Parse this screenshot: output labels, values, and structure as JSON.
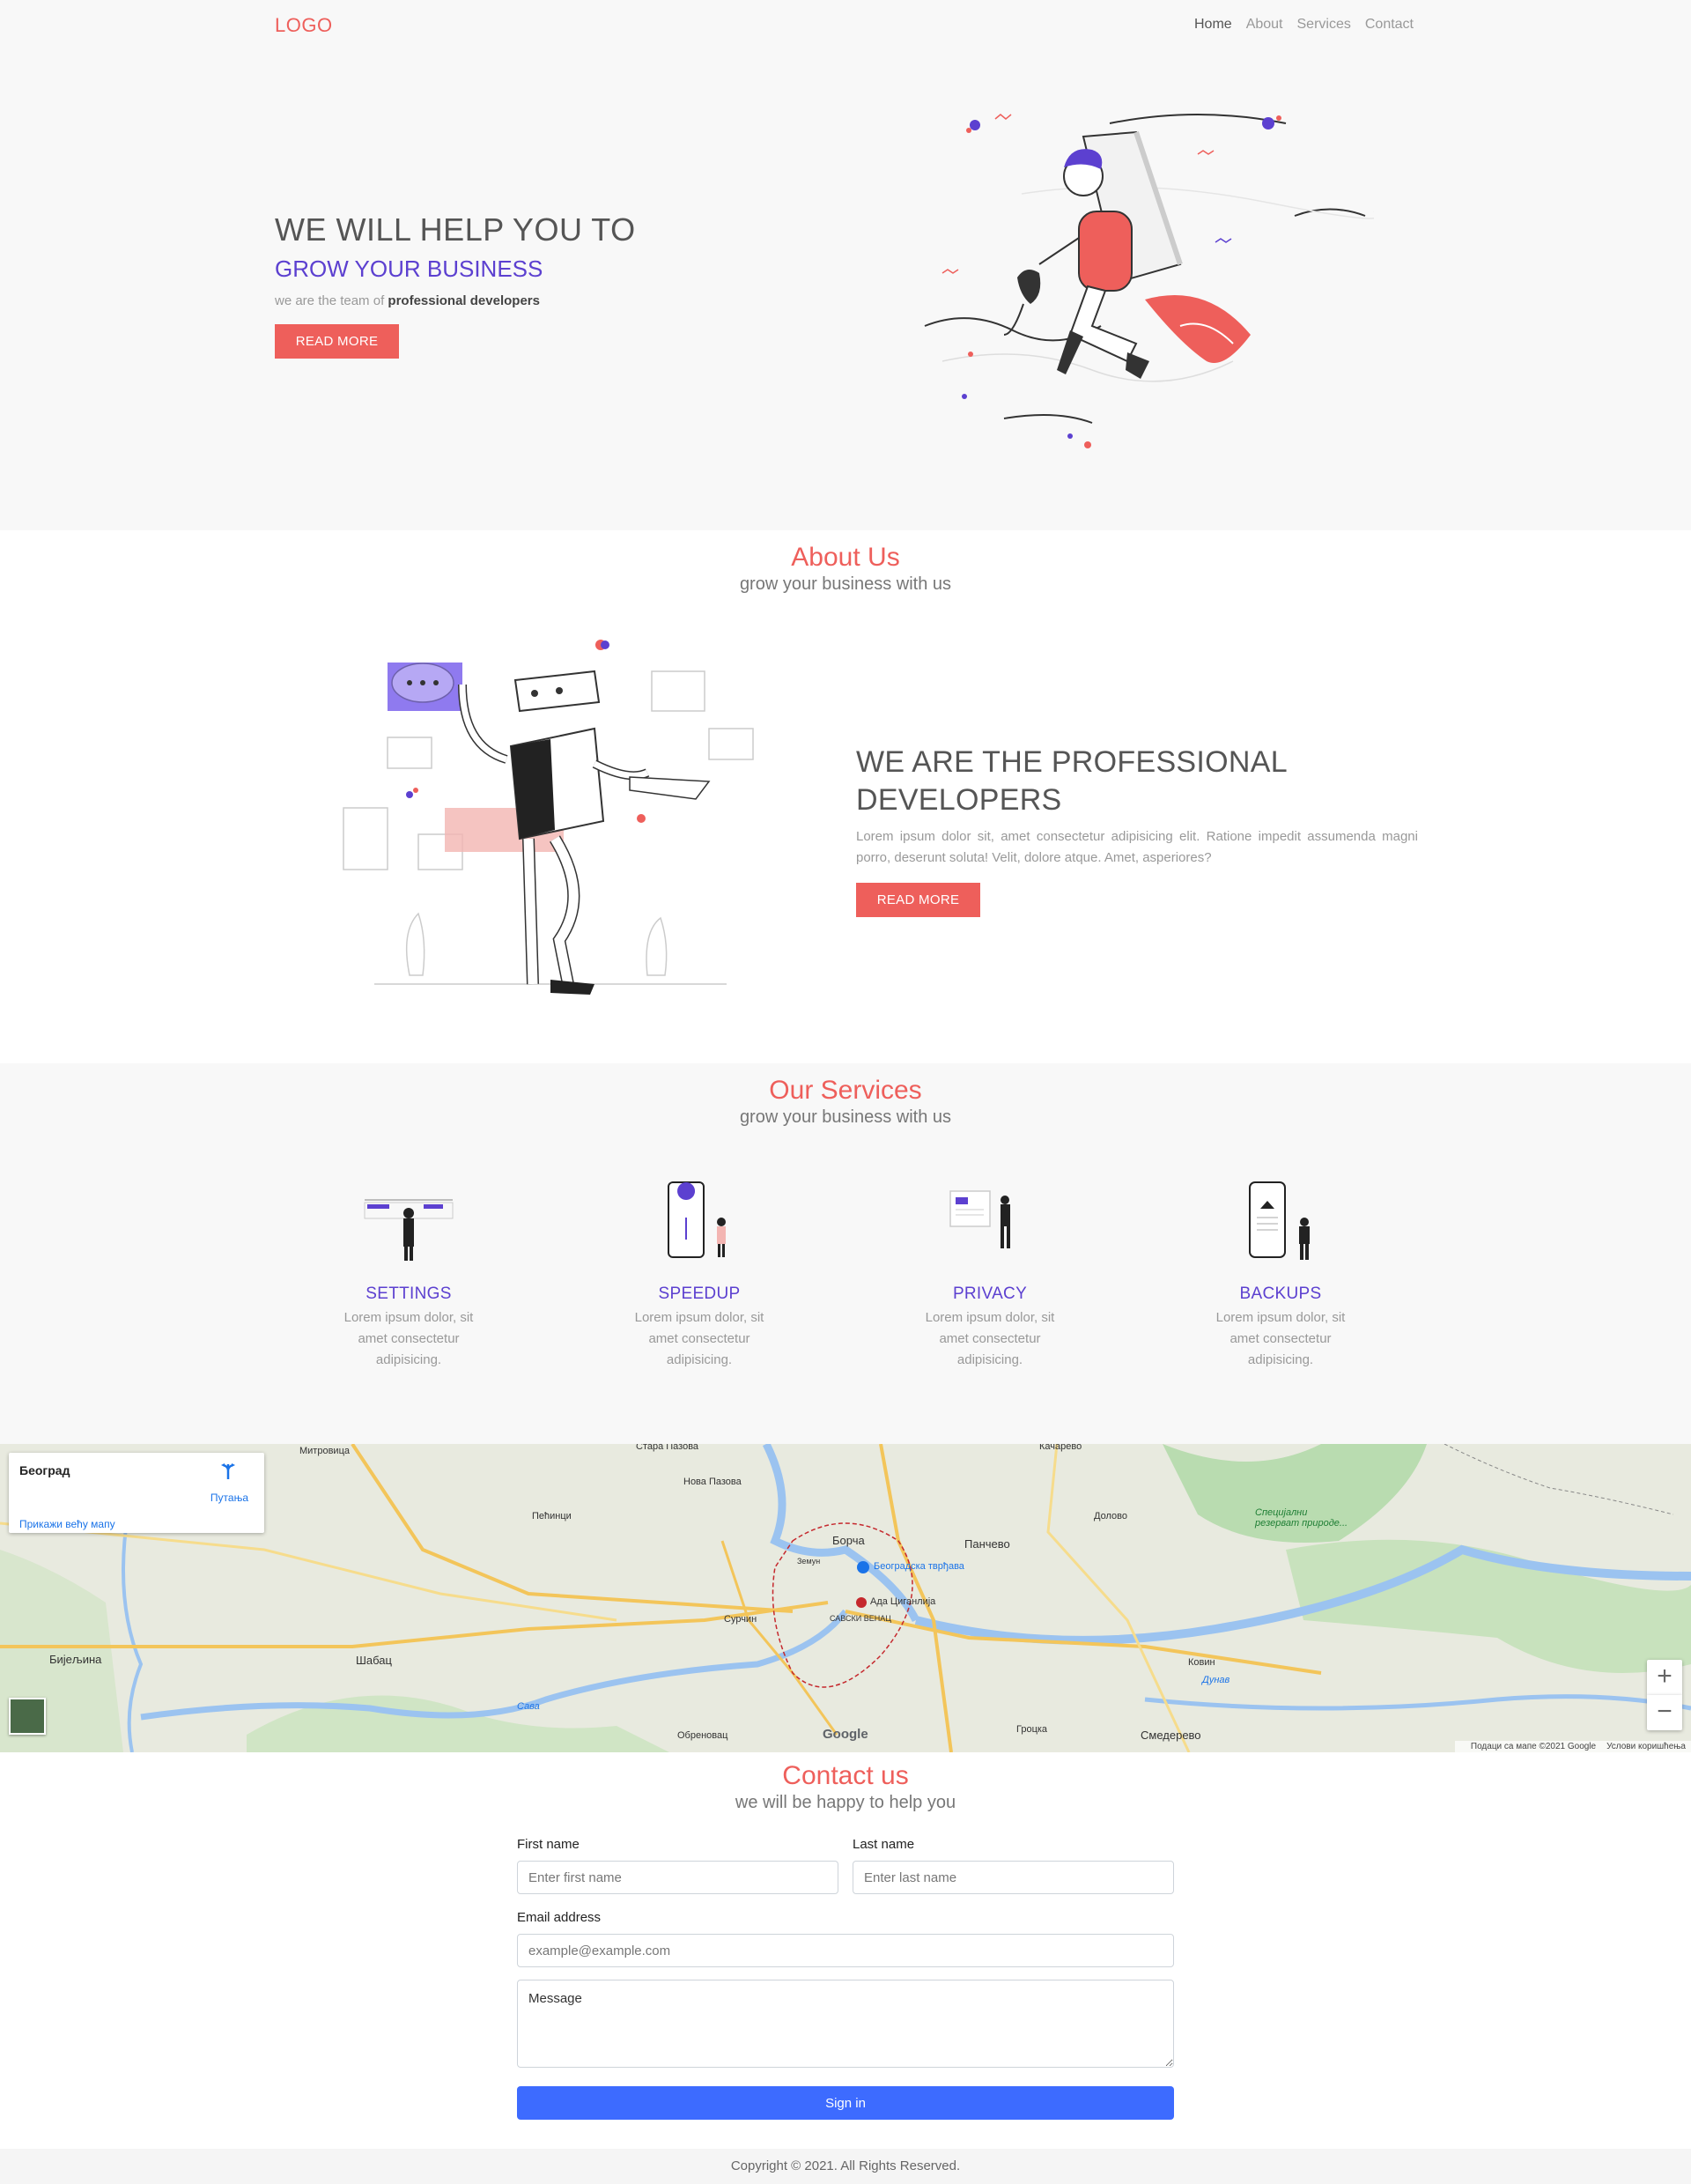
{
  "nav": {
    "logo": "LOGO",
    "links": [
      "Home",
      "About",
      "Services",
      "Contact"
    ]
  },
  "hero": {
    "title": "WE WILL HELP YOU TO",
    "subtitle": "GROW YOUR BUSINESS",
    "tagline_prefix": "we are the team of ",
    "tagline_bold": "professional developers",
    "button": "READ MORE"
  },
  "about": {
    "title": "About Us",
    "subtitle": "grow your business with us",
    "heading": "WE ARE THE PROFESSIONAL DEVELOPERS",
    "text": "Lorem ipsum dolor sit, amet consectetur adipisicing elit. Ratione impedit assumenda magni porro, deserunt soluta! Velit, dolore atque. Amet, asperiores?",
    "button": "READ MORE"
  },
  "services": {
    "title": "Our Services",
    "subtitle": "grow your business with us",
    "items": [
      {
        "name": "SETTINGS",
        "desc": "Lorem ipsum dolor, sit amet consectetur adipisicing."
      },
      {
        "name": "SPEEDUP",
        "desc": "Lorem ipsum dolor, sit amet consectetur adipisicing."
      },
      {
        "name": "PRIVACY",
        "desc": "Lorem ipsum dolor, sit amet consectetur adipisicing."
      },
      {
        "name": "BACKUPS",
        "desc": "Lorem ipsum dolor, sit amet consectetur adipisicing."
      }
    ]
  },
  "map": {
    "city": "Београд",
    "route": "Путања",
    "bigger_map": "Прикажи већу мапу",
    "attribution": "Подаци са мапе ©2021 Google",
    "terms": "Услови коришћења",
    "google": "Google",
    "labels": {
      "mitrovica": "Митровица",
      "stara_pazova": "Стара Пазова",
      "nova_pazova": "Нова Пазова",
      "pecinci": "Пећинци",
      "borca": "Борча",
      "pancevo": "Панчево",
      "zemun": "Земун",
      "beograd_tvrdjava": "Београдска тврђава",
      "ada": "Ада Циганлија",
      "savski_venac": "САВСКИ ВЕНАЦ",
      "surcin": "Сурчин",
      "sabac": "Шабац",
      "obrenovac": "Обреновац",
      "smederevo": "Смедерево",
      "bijeljina": "Бијељина",
      "kacarevo": "Качарево",
      "dolovo": "Долово",
      "special": "Специјални резерват природе...",
      "kovin": "Ковин",
      "grocka": "Гроцка",
      "sava": "Сава",
      "dunav": "Дунав"
    }
  },
  "contact": {
    "title": "Contact us",
    "subtitle": "we will be happy to help you",
    "first_label": "First name",
    "first_placeholder": "Enter first name",
    "last_label": "Last name",
    "last_placeholder": "Enter last name",
    "email_label": "Email address",
    "email_placeholder": "example@example.com",
    "message_placeholder": "Message",
    "submit": "Sign in"
  },
  "footer": {
    "copyright": "Copyright © 2021. All Rights Reserved."
  },
  "colors": {
    "accent_red": "#ee5f5b",
    "accent_purple": "#5c40d0",
    "button_blue": "#3d6bff"
  }
}
